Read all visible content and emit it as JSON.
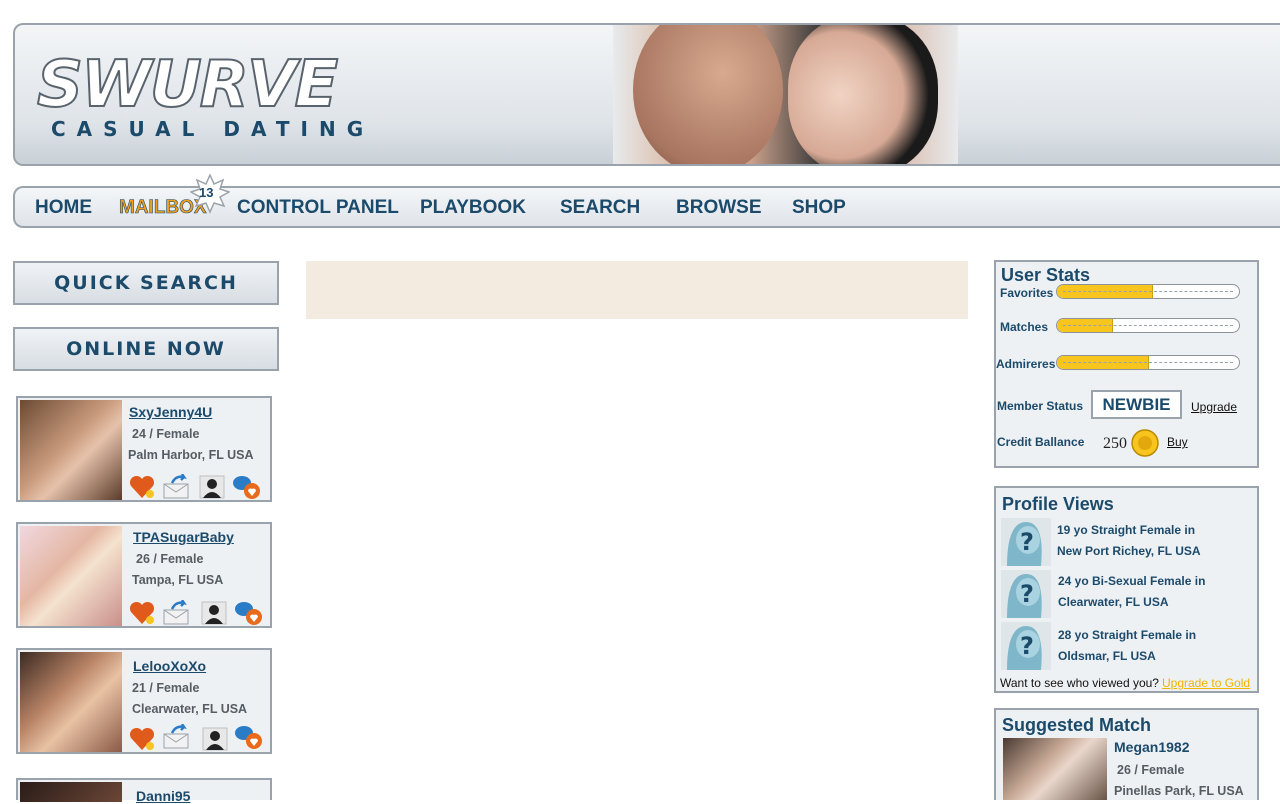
{
  "brand": {
    "name": "SWURVE",
    "tagline": "CASUAL DATING"
  },
  "nav": {
    "items": [
      "HOME",
      "MAILBOX",
      "CONTROL PANEL",
      "PLAYBOOK",
      "SEARCH",
      "BROWSE",
      "SHOP"
    ],
    "mail_count": "13"
  },
  "sidebar": {
    "quick_search": "QUICK SEARCH",
    "online_now": "ONLINE NOW",
    "profiles": [
      {
        "name": "SxyJenny4U",
        "age_gender": "24 / Female",
        "location": "Palm Harbor, FL USA"
      },
      {
        "name": "TPASugarBaby",
        "age_gender": "26 / Female",
        "location": "Tampa, FL USA"
      },
      {
        "name": "LelooXoXo",
        "age_gender": "21 / Female",
        "location": "Clearwater, FL USA"
      },
      {
        "name": "Danni95"
      }
    ],
    "icons": [
      "heart-icon",
      "send-message-icon",
      "profile-icon",
      "chat-icon"
    ]
  },
  "user_stats": {
    "title": "User Stats",
    "favorites_label": "Favorites",
    "favorites_level": 0.52,
    "matches_label": "Matches",
    "matches_level": 0.3,
    "admirers_label": "Admireres",
    "admirers_level": 0.5,
    "member_status_label": "Member Status",
    "member_status": "NEWBIE",
    "upgrade_label": "Upgrade",
    "credit_label": "Credit Ballance",
    "credit_value": "250",
    "buy_label": "Buy"
  },
  "profile_views": {
    "title": "Profile Views",
    "items": [
      {
        "line1": "19 yo Straight Female in",
        "line2": "New Port Richey, FL USA"
      },
      {
        "line1": "24 yo Bi-Sexual Female in",
        "line2": "Clearwater, FL USA"
      },
      {
        "line1": "28 yo Straight Female in",
        "line2": "Oldsmar, FL USA"
      }
    ],
    "prompt": "Want to see who viewed you?",
    "upgrade_link": "Upgrade to Gold"
  },
  "suggested_match": {
    "title": "Suggested Match",
    "name": "Megan1982",
    "age_gender": "26 / Female",
    "location": "Pinellas Park, FL USA"
  },
  "colors": {
    "brand": "#1b4a6b",
    "accent": "#f7c51e",
    "link_gold": "#f0b400",
    "center_bg": "#f3ebe0"
  }
}
